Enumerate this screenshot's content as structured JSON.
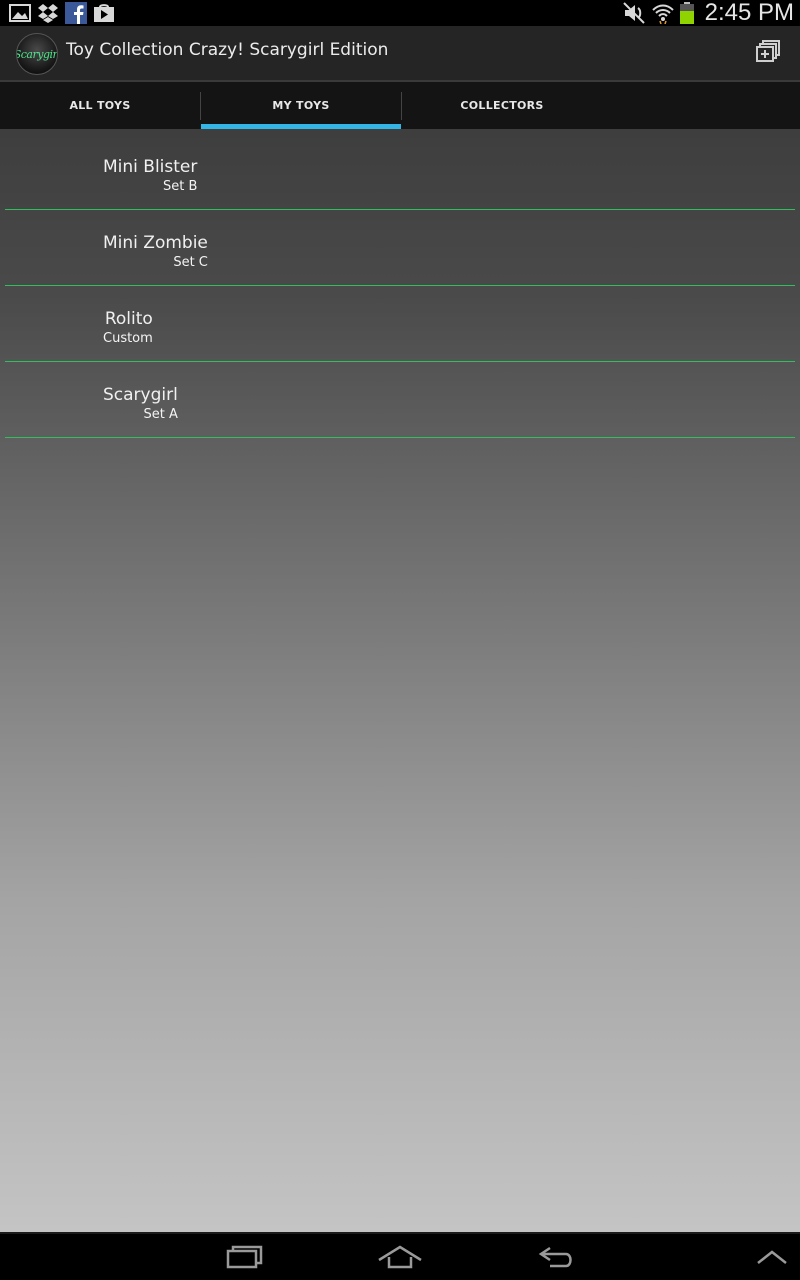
{
  "status_bar": {
    "left_icons": [
      "gallery-icon",
      "dropbox-icon",
      "facebook-icon",
      "play-store-icon"
    ],
    "right_icons": [
      "mute-icon",
      "wifi-icon",
      "battery-icon"
    ],
    "time": "2:45 PM"
  },
  "action_bar": {
    "logo_text": "Scarygirl",
    "title": "Toy Collection Crazy! Scarygirl Edition",
    "overflow_icon": "window-stack-icon"
  },
  "tabs": [
    {
      "label": "ALL TOYS",
      "selected": false
    },
    {
      "label": "MY TOYS",
      "selected": true
    },
    {
      "label": "COLLECTORS",
      "selected": false
    }
  ],
  "toys": [
    {
      "name": "Mini Blister",
      "set": "Set B"
    },
    {
      "name": "Mini Zombie",
      "set": "Set C"
    },
    {
      "name": "Rolito",
      "set": "Custom"
    },
    {
      "name": "Scarygirl",
      "set": "Set A"
    }
  ],
  "nav_bar": {
    "buttons": [
      "recent-apps-icon",
      "home-icon",
      "back-icon",
      "menu-up-icon"
    ]
  },
  "colors": {
    "accent": "#33b5e5",
    "divider": "#2fbf5f",
    "action_bar": "#252525"
  }
}
